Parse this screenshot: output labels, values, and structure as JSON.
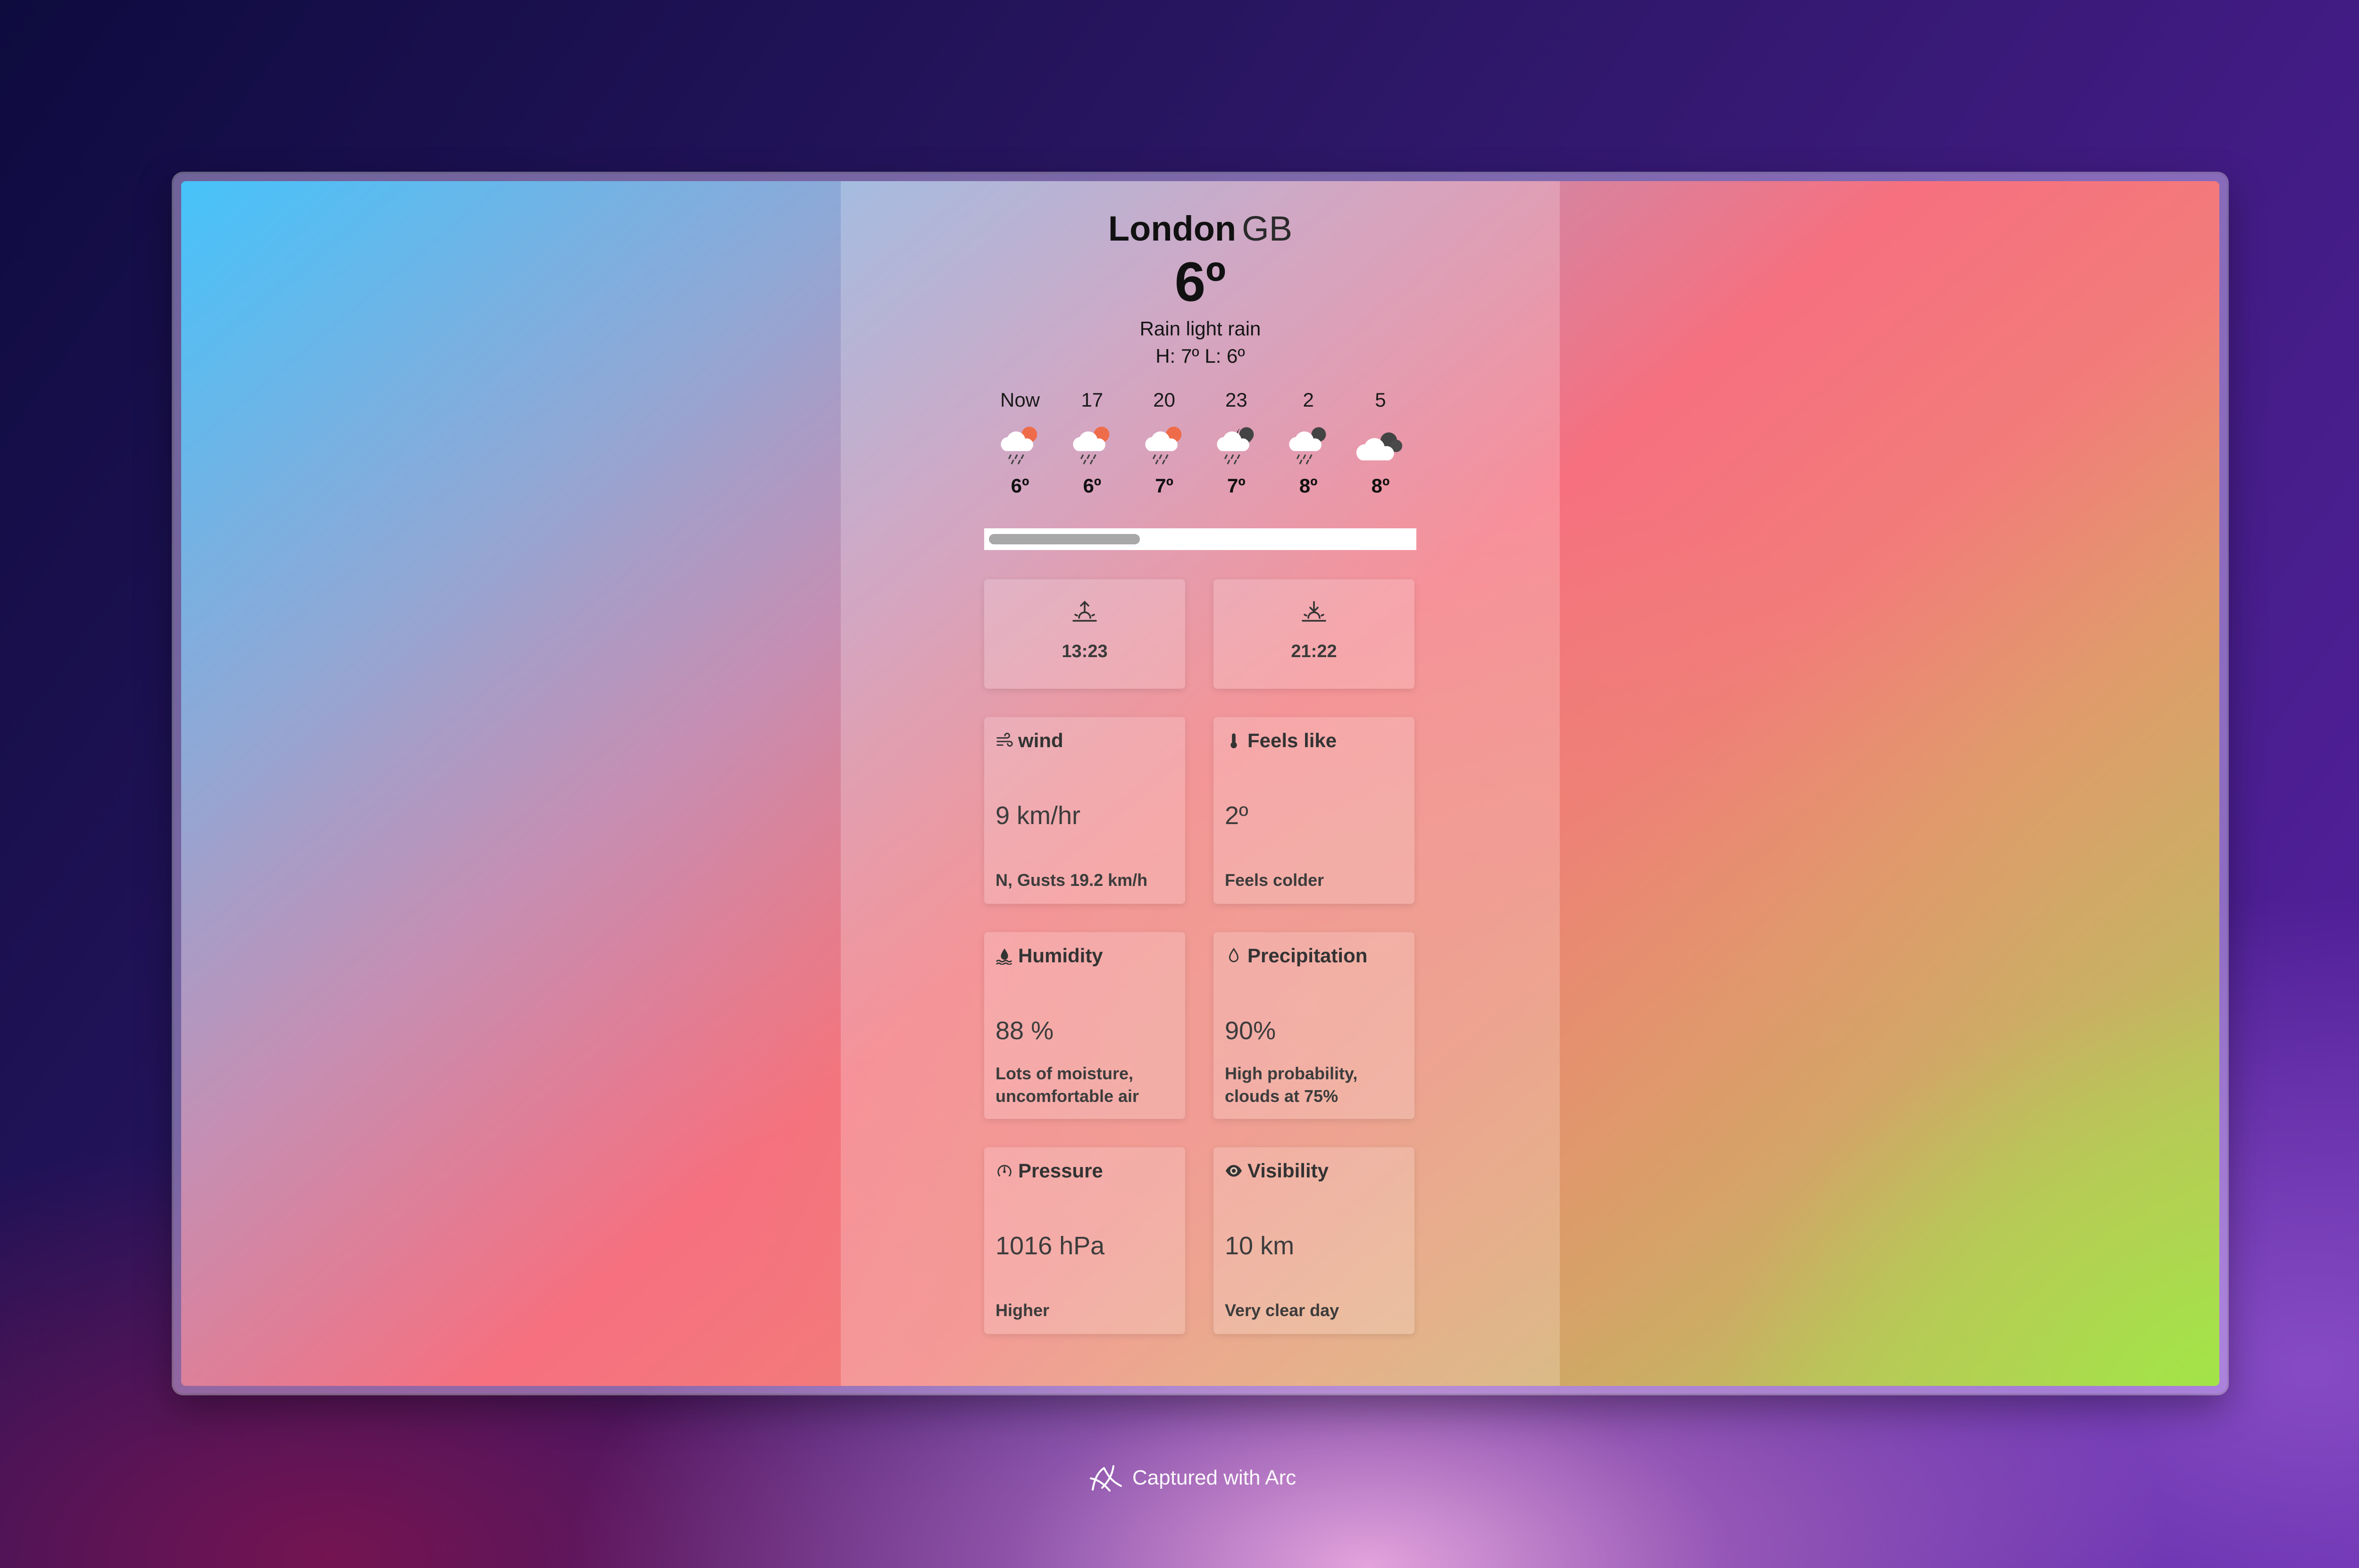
{
  "location": {
    "city": "London",
    "country": "GB"
  },
  "current": {
    "temperature": "6º",
    "description": "Rain light rain",
    "high_low": "H: 7º L: 6º"
  },
  "hourly": [
    {
      "time": "Now",
      "temp": "6º",
      "icon": "rain-day-icon"
    },
    {
      "time": "17",
      "temp": "6º",
      "icon": "rain-day-icon"
    },
    {
      "time": "20",
      "temp": "7º",
      "icon": "rain-day-icon"
    },
    {
      "time": "23",
      "temp": "7º",
      "icon": "rain-night-icon"
    },
    {
      "time": "2",
      "temp": "8º",
      "icon": "rain-night-icon"
    },
    {
      "time": "5",
      "temp": "8º",
      "icon": "cloudy-night-icon"
    }
  ],
  "hourly_scroll_position": 0.12,
  "sun": {
    "sunrise": "13:23",
    "sunset": "21:22"
  },
  "cards": {
    "wind": {
      "title": "wind",
      "value": "9 km/hr",
      "note": "N, Gusts 19.2 km/h"
    },
    "feels_like": {
      "title": "Feels like",
      "value": "2º",
      "note": "Feels colder"
    },
    "humidity": {
      "title": "Humidity",
      "value": "88 %",
      "note": "Lots of moisture, uncomfortable air"
    },
    "precipitation": {
      "title": "Precipitation",
      "value": "90%",
      "note": "High probability, clouds at 75%"
    },
    "pressure": {
      "title": "Pressure",
      "value": "1016 hPa",
      "note": "Higher"
    },
    "visibility": {
      "title": "Visibility",
      "value": "10 km",
      "note": "Very clear day"
    }
  },
  "footer": {
    "text": "Captured with Arc"
  }
}
